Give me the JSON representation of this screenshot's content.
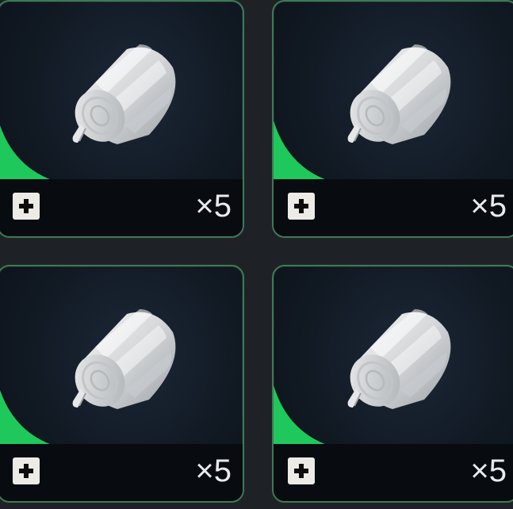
{
  "inventory": {
    "slots": [
      {
        "item_icon": "bandage-roll-icon",
        "count_text": "×5",
        "add_icon": "plus-icon",
        "rarity_color": "#1ec85a"
      },
      {
        "item_icon": "bandage-roll-icon",
        "count_text": "×5",
        "add_icon": "plus-icon",
        "rarity_color": "#1ec85a"
      },
      {
        "item_icon": "bandage-roll-icon",
        "count_text": "×5",
        "add_icon": "plus-icon",
        "rarity_color": "#1ec85a"
      },
      {
        "item_icon": "bandage-roll-icon",
        "count_text": "×5",
        "add_icon": "plus-icon",
        "rarity_color": "#1ec85a"
      }
    ]
  },
  "colors": {
    "slot_border": "#3f7a55",
    "slot_background": "#111923",
    "info_bar": "#080c11",
    "count_text": "#e9eaec",
    "button_bg": "#ecebe6"
  }
}
